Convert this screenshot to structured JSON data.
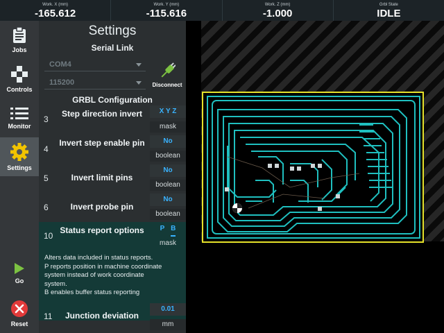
{
  "dro": [
    {
      "label": "Work. X (mm)",
      "value": "-165.612"
    },
    {
      "label": "Work. Y (mm)",
      "value": "-115.616"
    },
    {
      "label": "Work. Z (mm)",
      "value": "-1.000"
    },
    {
      "label": "Grbl State",
      "value": "IDLE"
    }
  ],
  "nav": {
    "jobs": "Jobs",
    "controls": "Controls",
    "monitor": "Monitor",
    "settings": "Settings",
    "go": "Go",
    "reset": "Reset"
  },
  "panel": {
    "title": "Settings",
    "serial_link": "Serial Link",
    "port": "COM4",
    "baud": "115200",
    "disconnect": "Disconnect",
    "grbl_config": "GRBL Configuration"
  },
  "settings": [
    {
      "num": "3",
      "name": "Step direction invert",
      "value": "X  Y  Z",
      "unit": "mask"
    },
    {
      "num": "4",
      "name": "Invert step enable pin",
      "value": "No",
      "unit": "boolean"
    },
    {
      "num": "5",
      "name": "Invert limit pins",
      "value": "No",
      "unit": "boolean"
    },
    {
      "num": "6",
      "name": "Invert probe pin",
      "value": "No",
      "unit": "boolean"
    },
    {
      "num": "10",
      "name": "Status report options",
      "value_p": "P",
      "value_b": "B",
      "unit": "mask",
      "desc": [
        "Alters data included in status reports.",
        "P reports position in machine coordinate",
        "system instead of work coordinate",
        "system.",
        "B enables buffer status reporting"
      ]
    },
    {
      "num": "11",
      "name": "Junction deviation",
      "value": "0.01",
      "unit": "mm"
    }
  ],
  "colors": {
    "accent": "#39b3ff",
    "trace": "#1fbfbf",
    "border_yellow": "#e6e22a",
    "settings_icon": "#f2c400",
    "go_icon": "#7cc242",
    "reset_icon": "#e23a3a"
  }
}
